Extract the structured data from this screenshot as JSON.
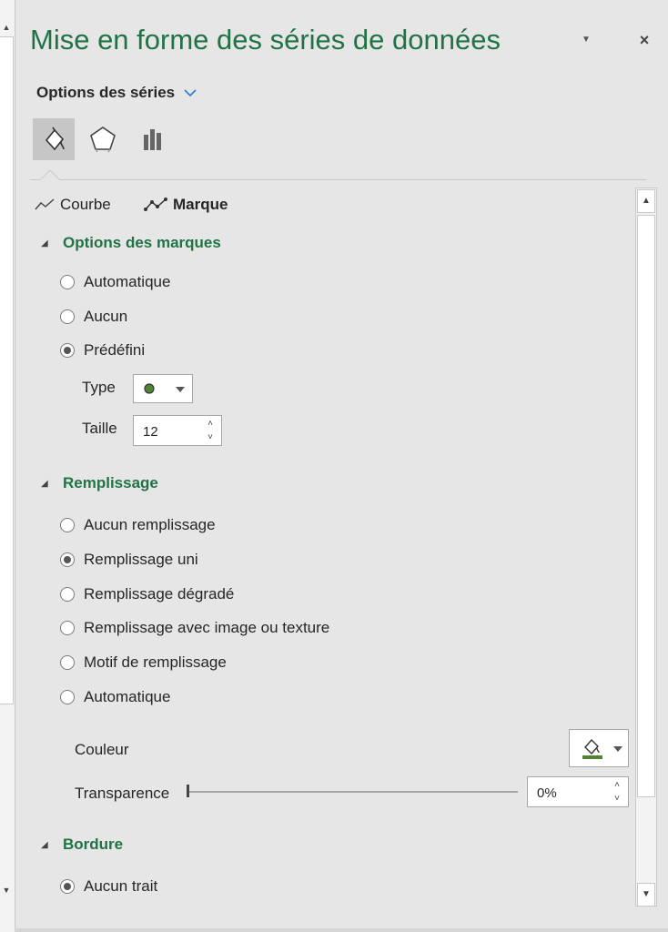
{
  "pane": {
    "title": "Mise en forme des séries de données",
    "options_dropdown": "Options des séries",
    "icon_tabs": [
      "fill-line-icon",
      "effects-pentagon-icon",
      "series-options-bar-icon"
    ]
  },
  "subtabs": {
    "line": "Courbe",
    "marker": "Marque"
  },
  "marker_options": {
    "heading": "Options des marques",
    "options": [
      {
        "label": "Automatique",
        "selected": false
      },
      {
        "label": "Aucun",
        "selected": false
      },
      {
        "label": "Prédéfini",
        "selected": true
      }
    ],
    "type_label": "Type",
    "size_label": "Taille",
    "size_value": "12"
  },
  "fill": {
    "heading": "Remplissage",
    "options": [
      {
        "label": "Aucun remplissage",
        "selected": false
      },
      {
        "label": "Remplissage uni",
        "selected": true
      },
      {
        "label": "Remplissage dégradé",
        "selected": false
      },
      {
        "label": "Remplissage avec image ou texture",
        "selected": false
      },
      {
        "label": "Motif de remplissage",
        "selected": false
      },
      {
        "label": "Automatique",
        "selected": false
      }
    ],
    "color_label": "Couleur",
    "transparency_label": "Transparence",
    "transparency_value": "0%",
    "transparency_fraction": 0,
    "color_accent": "#548235"
  },
  "border": {
    "heading": "Bordure",
    "options": [
      {
        "label": "Aucun trait",
        "selected": true
      }
    ]
  },
  "colors": {
    "accent": "#217346",
    "marker_fill": "#548235"
  }
}
